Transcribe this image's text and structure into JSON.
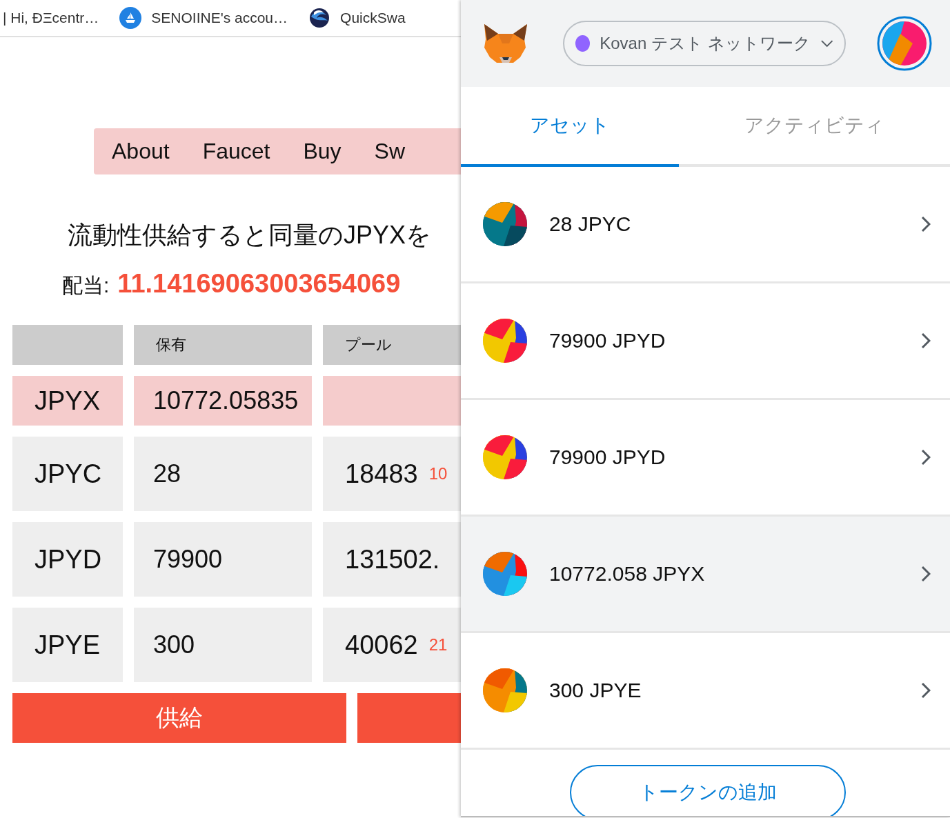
{
  "bookmarks": [
    "| Hi, ÐΞcentr…",
    "SENOIINE's accou…",
    "QuickSwa"
  ],
  "nav": [
    "About",
    "Faucet",
    "Buy",
    "Sw"
  ],
  "heading": "流動性供給すると同量のJPYXを",
  "dividend": {
    "label": "配当:",
    "value": "11.14169063003654069"
  },
  "table": {
    "columns": [
      "",
      "保有",
      "プール"
    ],
    "rows": [
      {
        "token": "JPYX",
        "held": "10772.05835",
        "selected": true
      },
      {
        "token": "JPYC",
        "held": "28",
        "pool": "18483",
        "reward": "10",
        "selected": false
      },
      {
        "token": "JPYD",
        "held": "79900",
        "pool": "131502.",
        "selected": false
      },
      {
        "token": "JPYE",
        "held": "300",
        "pool": "40062",
        "reward": "21",
        "selected": false
      }
    ]
  },
  "buttons": [
    "供給"
  ],
  "wallet": {
    "network": "Kovan テスト ネットワーク",
    "tabs": [
      {
        "label": "アセット",
        "selected": true
      },
      {
        "label": "アクティビティ",
        "selected": false
      }
    ],
    "assets": [
      {
        "label": "28 JPYC",
        "selected": false
      },
      {
        "label": "79900 JPYD",
        "selected": false
      },
      {
        "label": "79900 JPYD",
        "selected": false
      },
      {
        "label": "10772.058 JPYX",
        "selected": true
      },
      {
        "label": "300 JPYE",
        "selected": false
      }
    ],
    "add_button": "トークンの追加"
  }
}
